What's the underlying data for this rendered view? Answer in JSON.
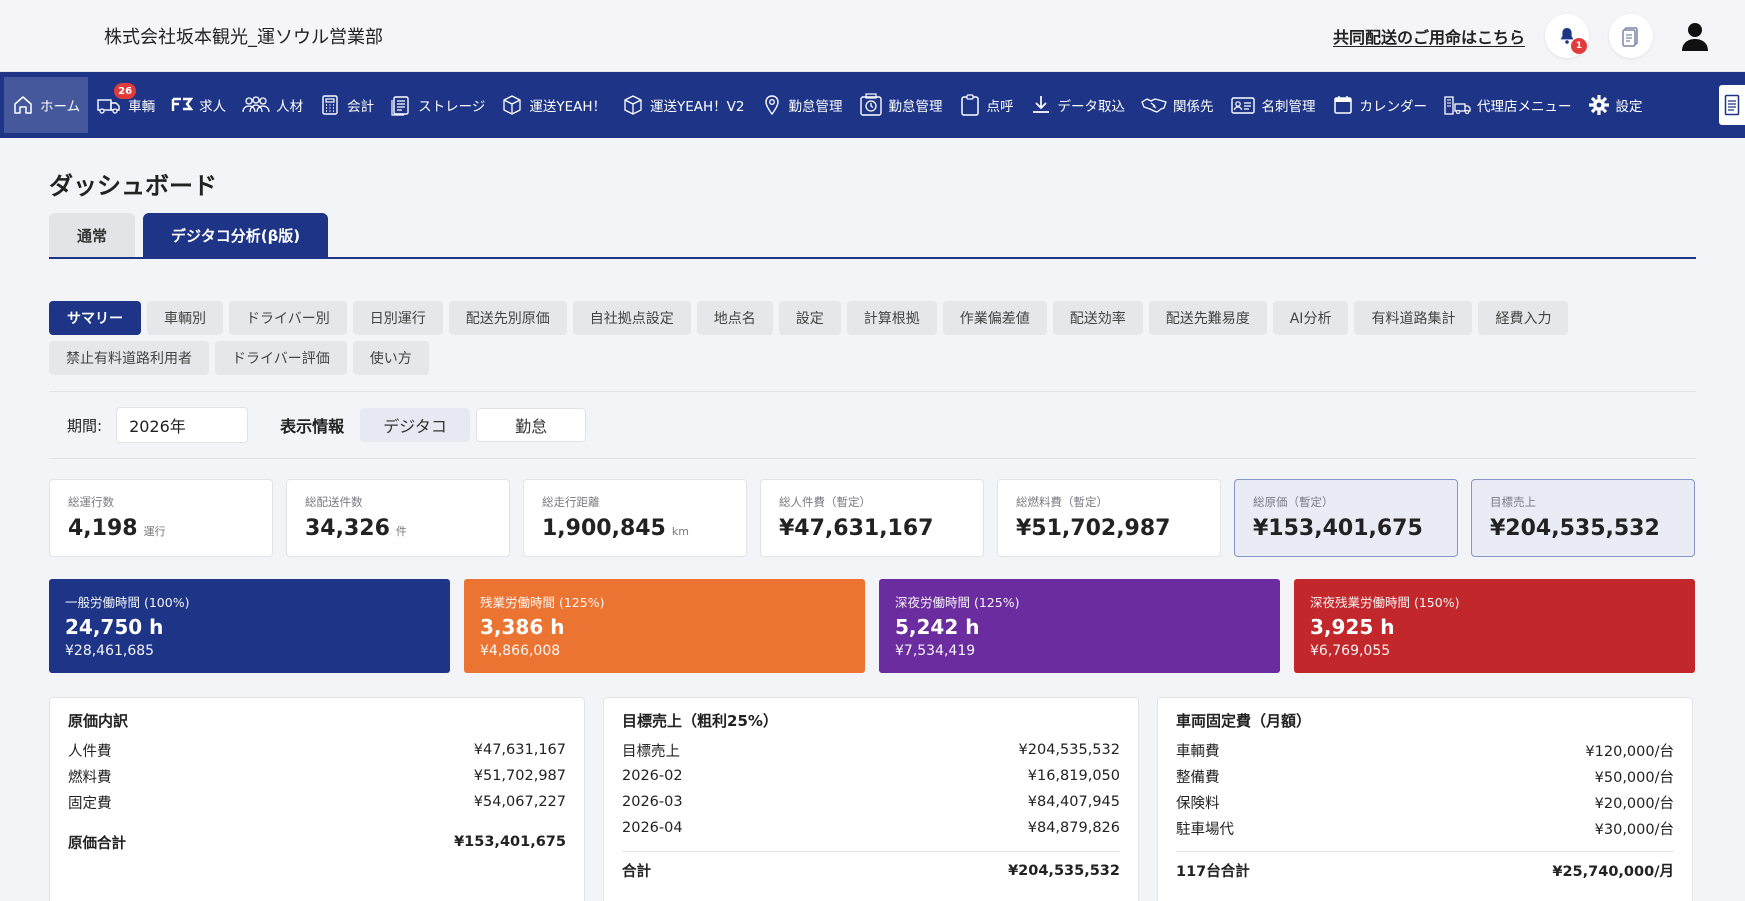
{
  "header": {
    "company": "株式会社坂本観光_運ソウル営業部",
    "co_delivery_link": "共同配送のご用命はこちら",
    "notification_count": "1"
  },
  "nav": {
    "items": [
      {
        "label": "ホーム",
        "icon": "home-icon",
        "active": true
      },
      {
        "label": "車輌",
        "icon": "truck-icon",
        "badge": "26"
      },
      {
        "label": "求人",
        "icon": "job-icon"
      },
      {
        "label": "人材",
        "icon": "people-icon"
      },
      {
        "label": "会計",
        "icon": "calculator-icon"
      },
      {
        "label": "ストレージ",
        "icon": "storage-icon"
      },
      {
        "label": "運送YEAH！",
        "icon": "box-icon"
      },
      {
        "label": "運送YEAH！V2",
        "icon": "box-icon"
      },
      {
        "label": "勤怠管理",
        "icon": "location-pin-icon"
      },
      {
        "label": "勤怠管理",
        "icon": "time-clock-icon"
      },
      {
        "label": "点呼",
        "icon": "clipboard-icon"
      },
      {
        "label": "データ取込",
        "icon": "download-icon"
      },
      {
        "label": "関係先",
        "icon": "handshake-icon"
      },
      {
        "label": "名刺管理",
        "icon": "business-card-icon"
      },
      {
        "label": "カレンダー",
        "icon": "calendar-icon"
      },
      {
        "label": "代理店メニュー",
        "icon": "agency-icon"
      },
      {
        "label": "設定",
        "icon": "gear-icon"
      }
    ]
  },
  "page": {
    "title": "ダッシュボード",
    "tabs": [
      "通常",
      "デジタコ分析(β版)"
    ]
  },
  "subtabs": [
    "サマリー",
    "車輌別",
    "ドライバー別",
    "日別運行",
    "配送先別原価",
    "自社拠点設定",
    "地点名",
    "設定",
    "計算根拠",
    "作業偏差値",
    "配送効率",
    "配送先難易度",
    "AI分析",
    "有料道路集計",
    "経費入力",
    "禁止有料道路利用者",
    "ドライバー評価",
    "使い方"
  ],
  "filter": {
    "period_label": "期間:",
    "period_value": "2026年",
    "display_label": "表示情報",
    "toggle": [
      "デジタコ",
      "勤怠"
    ]
  },
  "kpis": [
    {
      "label": "総運行数",
      "value": "4,198",
      "unit": "運行"
    },
    {
      "label": "総配送件数",
      "value": "34,326",
      "unit": "件"
    },
    {
      "label": "総走行距離",
      "value": "1,900,845",
      "unit": "km"
    },
    {
      "label": "総人件費（暫定）",
      "value": "¥47,631,167",
      "unit": ""
    },
    {
      "label": "総燃料費（暫定）",
      "value": "¥51,702,987",
      "unit": ""
    },
    {
      "label": "総原価（暫定）",
      "value": "¥153,401,675",
      "unit": ""
    },
    {
      "label": "目標売上",
      "value": "¥204,535,532",
      "unit": ""
    }
  ],
  "labor": [
    {
      "label": "一般労働時間 (100%)",
      "hours": "24,750 h",
      "yen": "¥28,461,685",
      "color": "#1d3487"
    },
    {
      "label": "残業労働時間 (125%)",
      "hours": "3,386 h",
      "yen": "¥4,866,008",
      "color": "#ec7433"
    },
    {
      "label": "深夜労働時間 (125%)",
      "hours": "5,242 h",
      "yen": "¥7,534,419",
      "color": "#6a2c9e"
    },
    {
      "label": "深夜残業労働時間 (150%)",
      "hours": "3,925 h",
      "yen": "¥6,769,055",
      "color": "#c1272b"
    }
  ],
  "cost": {
    "title": "原価内訳",
    "rows": [
      {
        "k": "人件費",
        "v": "¥47,631,167"
      },
      {
        "k": "燃料費",
        "v": "¥51,702,987"
      },
      {
        "k": "固定費",
        "v": "¥54,067,227"
      }
    ],
    "total_k": "原価合計",
    "total_v": "¥153,401,675"
  },
  "target": {
    "title": "目標売上（粗利25%）",
    "rows": [
      {
        "k": "目標売上",
        "v": "¥204,535,532"
      },
      {
        "k": "2026-02",
        "v": "¥16,819,050"
      },
      {
        "k": "2026-03",
        "v": "¥84,407,945"
      },
      {
        "k": "2026-04",
        "v": "¥84,879,826"
      }
    ],
    "total_k": "合計",
    "total_v": "¥204,535,532"
  },
  "fixed": {
    "title": "車両固定費（月額）",
    "rows": [
      {
        "k": "車輌費",
        "v": "¥120,000/台"
      },
      {
        "k": "整備費",
        "v": "¥50,000/台"
      },
      {
        "k": "保険料",
        "v": "¥20,000/台"
      },
      {
        "k": "駐車場代",
        "v": "¥30,000/台"
      }
    ],
    "total_k": "117台合計",
    "total_v": "¥25,740,000/月"
  }
}
